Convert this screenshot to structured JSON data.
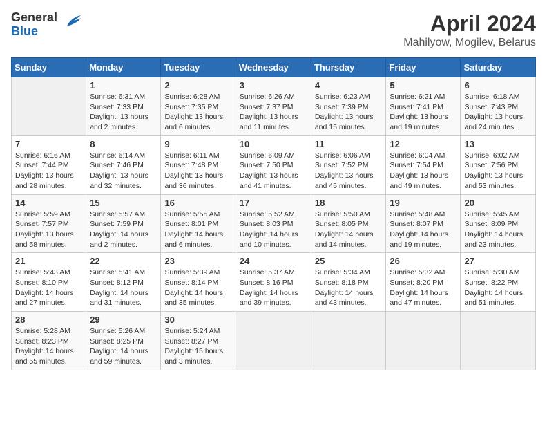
{
  "logo": {
    "line1": "General",
    "line2": "Blue"
  },
  "title": "April 2024",
  "subtitle": "Mahilyow, Mogilev, Belarus",
  "days_of_week": [
    "Sunday",
    "Monday",
    "Tuesday",
    "Wednesday",
    "Thursday",
    "Friday",
    "Saturday"
  ],
  "weeks": [
    [
      {
        "day": "",
        "sunrise": "",
        "sunset": "",
        "daylight": ""
      },
      {
        "day": "1",
        "sunrise": "Sunrise: 6:31 AM",
        "sunset": "Sunset: 7:33 PM",
        "daylight": "Daylight: 13 hours and 2 minutes."
      },
      {
        "day": "2",
        "sunrise": "Sunrise: 6:28 AM",
        "sunset": "Sunset: 7:35 PM",
        "daylight": "Daylight: 13 hours and 6 minutes."
      },
      {
        "day": "3",
        "sunrise": "Sunrise: 6:26 AM",
        "sunset": "Sunset: 7:37 PM",
        "daylight": "Daylight: 13 hours and 11 minutes."
      },
      {
        "day": "4",
        "sunrise": "Sunrise: 6:23 AM",
        "sunset": "Sunset: 7:39 PM",
        "daylight": "Daylight: 13 hours and 15 minutes."
      },
      {
        "day": "5",
        "sunrise": "Sunrise: 6:21 AM",
        "sunset": "Sunset: 7:41 PM",
        "daylight": "Daylight: 13 hours and 19 minutes."
      },
      {
        "day": "6",
        "sunrise": "Sunrise: 6:18 AM",
        "sunset": "Sunset: 7:43 PM",
        "daylight": "Daylight: 13 hours and 24 minutes."
      }
    ],
    [
      {
        "day": "7",
        "sunrise": "Sunrise: 6:16 AM",
        "sunset": "Sunset: 7:44 PM",
        "daylight": "Daylight: 13 hours and 28 minutes."
      },
      {
        "day": "8",
        "sunrise": "Sunrise: 6:14 AM",
        "sunset": "Sunset: 7:46 PM",
        "daylight": "Daylight: 13 hours and 32 minutes."
      },
      {
        "day": "9",
        "sunrise": "Sunrise: 6:11 AM",
        "sunset": "Sunset: 7:48 PM",
        "daylight": "Daylight: 13 hours and 36 minutes."
      },
      {
        "day": "10",
        "sunrise": "Sunrise: 6:09 AM",
        "sunset": "Sunset: 7:50 PM",
        "daylight": "Daylight: 13 hours and 41 minutes."
      },
      {
        "day": "11",
        "sunrise": "Sunrise: 6:06 AM",
        "sunset": "Sunset: 7:52 PM",
        "daylight": "Daylight: 13 hours and 45 minutes."
      },
      {
        "day": "12",
        "sunrise": "Sunrise: 6:04 AM",
        "sunset": "Sunset: 7:54 PM",
        "daylight": "Daylight: 13 hours and 49 minutes."
      },
      {
        "day": "13",
        "sunrise": "Sunrise: 6:02 AM",
        "sunset": "Sunset: 7:56 PM",
        "daylight": "Daylight: 13 hours and 53 minutes."
      }
    ],
    [
      {
        "day": "14",
        "sunrise": "Sunrise: 5:59 AM",
        "sunset": "Sunset: 7:57 PM",
        "daylight": "Daylight: 13 hours and 58 minutes."
      },
      {
        "day": "15",
        "sunrise": "Sunrise: 5:57 AM",
        "sunset": "Sunset: 7:59 PM",
        "daylight": "Daylight: 14 hours and 2 minutes."
      },
      {
        "day": "16",
        "sunrise": "Sunrise: 5:55 AM",
        "sunset": "Sunset: 8:01 PM",
        "daylight": "Daylight: 14 hours and 6 minutes."
      },
      {
        "day": "17",
        "sunrise": "Sunrise: 5:52 AM",
        "sunset": "Sunset: 8:03 PM",
        "daylight": "Daylight: 14 hours and 10 minutes."
      },
      {
        "day": "18",
        "sunrise": "Sunrise: 5:50 AM",
        "sunset": "Sunset: 8:05 PM",
        "daylight": "Daylight: 14 hours and 14 minutes."
      },
      {
        "day": "19",
        "sunrise": "Sunrise: 5:48 AM",
        "sunset": "Sunset: 8:07 PM",
        "daylight": "Daylight: 14 hours and 19 minutes."
      },
      {
        "day": "20",
        "sunrise": "Sunrise: 5:45 AM",
        "sunset": "Sunset: 8:09 PM",
        "daylight": "Daylight: 14 hours and 23 minutes."
      }
    ],
    [
      {
        "day": "21",
        "sunrise": "Sunrise: 5:43 AM",
        "sunset": "Sunset: 8:10 PM",
        "daylight": "Daylight: 14 hours and 27 minutes."
      },
      {
        "day": "22",
        "sunrise": "Sunrise: 5:41 AM",
        "sunset": "Sunset: 8:12 PM",
        "daylight": "Daylight: 14 hours and 31 minutes."
      },
      {
        "day": "23",
        "sunrise": "Sunrise: 5:39 AM",
        "sunset": "Sunset: 8:14 PM",
        "daylight": "Daylight: 14 hours and 35 minutes."
      },
      {
        "day": "24",
        "sunrise": "Sunrise: 5:37 AM",
        "sunset": "Sunset: 8:16 PM",
        "daylight": "Daylight: 14 hours and 39 minutes."
      },
      {
        "day": "25",
        "sunrise": "Sunrise: 5:34 AM",
        "sunset": "Sunset: 8:18 PM",
        "daylight": "Daylight: 14 hours and 43 minutes."
      },
      {
        "day": "26",
        "sunrise": "Sunrise: 5:32 AM",
        "sunset": "Sunset: 8:20 PM",
        "daylight": "Daylight: 14 hours and 47 minutes."
      },
      {
        "day": "27",
        "sunrise": "Sunrise: 5:30 AM",
        "sunset": "Sunset: 8:22 PM",
        "daylight": "Daylight: 14 hours and 51 minutes."
      }
    ],
    [
      {
        "day": "28",
        "sunrise": "Sunrise: 5:28 AM",
        "sunset": "Sunset: 8:23 PM",
        "daylight": "Daylight: 14 hours and 55 minutes."
      },
      {
        "day": "29",
        "sunrise": "Sunrise: 5:26 AM",
        "sunset": "Sunset: 8:25 PM",
        "daylight": "Daylight: 14 hours and 59 minutes."
      },
      {
        "day": "30",
        "sunrise": "Sunrise: 5:24 AM",
        "sunset": "Sunset: 8:27 PM",
        "daylight": "Daylight: 15 hours and 3 minutes."
      },
      {
        "day": "",
        "sunrise": "",
        "sunset": "",
        "daylight": ""
      },
      {
        "day": "",
        "sunrise": "",
        "sunset": "",
        "daylight": ""
      },
      {
        "day": "",
        "sunrise": "",
        "sunset": "",
        "daylight": ""
      },
      {
        "day": "",
        "sunrise": "",
        "sunset": "",
        "daylight": ""
      }
    ]
  ]
}
